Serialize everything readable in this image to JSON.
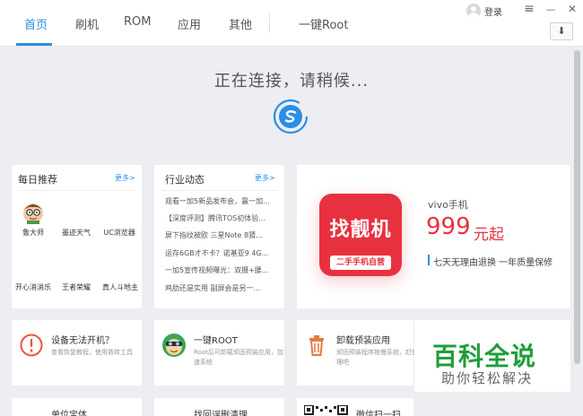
{
  "nav": {
    "tabs": [
      {
        "label": "首页"
      },
      {
        "label": "刷机"
      },
      {
        "label": "ROM"
      },
      {
        "label": "应用"
      },
      {
        "label": "其他"
      },
      {
        "label": "一键Root"
      }
    ],
    "active_index": 0,
    "login_label": "登录",
    "menu_glyph": "≡",
    "minimize_glyph": "—",
    "close_glyph": "✕",
    "download_glyph": "⬇"
  },
  "status": {
    "connecting_text": "正在连接，请稍候..."
  },
  "daily": {
    "title": "每日推荐",
    "more": "更多>",
    "apps": [
      {
        "label": "鲁大师"
      },
      {
        "label": "墨迹天气"
      },
      {
        "label": "UC浏览器"
      },
      {
        "label": "开心消消乐"
      },
      {
        "label": "王者荣耀"
      },
      {
        "label": "真人斗地主"
      }
    ]
  },
  "news": {
    "title": "行业动态",
    "more": "更多>",
    "items": [
      {
        "text": "观看一加5新品发布会，赢一加..."
      },
      {
        "text": "【深度评测】腾讯TOS初体验..."
      },
      {
        "text": "屏下指纹被欧 三星Note 8猜..."
      },
      {
        "text": "运存6GB才不卡？诺基亚9 4G..."
      },
      {
        "text": "一加5宣传视频曝光：双摄+腰..."
      },
      {
        "text": "鸡肋还是实用 副屏会是另一..."
      }
    ]
  },
  "ad": {
    "logo_text": "找靓机",
    "logo_band": "二手手机自营",
    "model": "vivo手机",
    "price": "999",
    "price_suffix": "元起",
    "slogan": "七天无理由退换 一年质量保修"
  },
  "tools": [
    {
      "title": "设备无法开机？",
      "desc": "查看恢复教程，使用救砖工具"
    },
    {
      "title": "一键ROOT",
      "desc": "Root后可卸载顽固预装应用，加速系统"
    },
    {
      "title": "卸载预装应用",
      "desc": "顽固预装程序拖慢系统，赶快清理吧"
    }
  ],
  "bottom_row": [
    {
      "text": "单位宝体"
    },
    {
      "text": "找回误删清理"
    },
    {
      "text": "微信扫一扫"
    }
  ],
  "watermark": {
    "main": "百科全说",
    "sub": "助你轻松解决"
  },
  "colors": {
    "accent": "#2a8ee8",
    "ad_red": "#e8313f",
    "watermark_green": "#1f9d3a"
  }
}
